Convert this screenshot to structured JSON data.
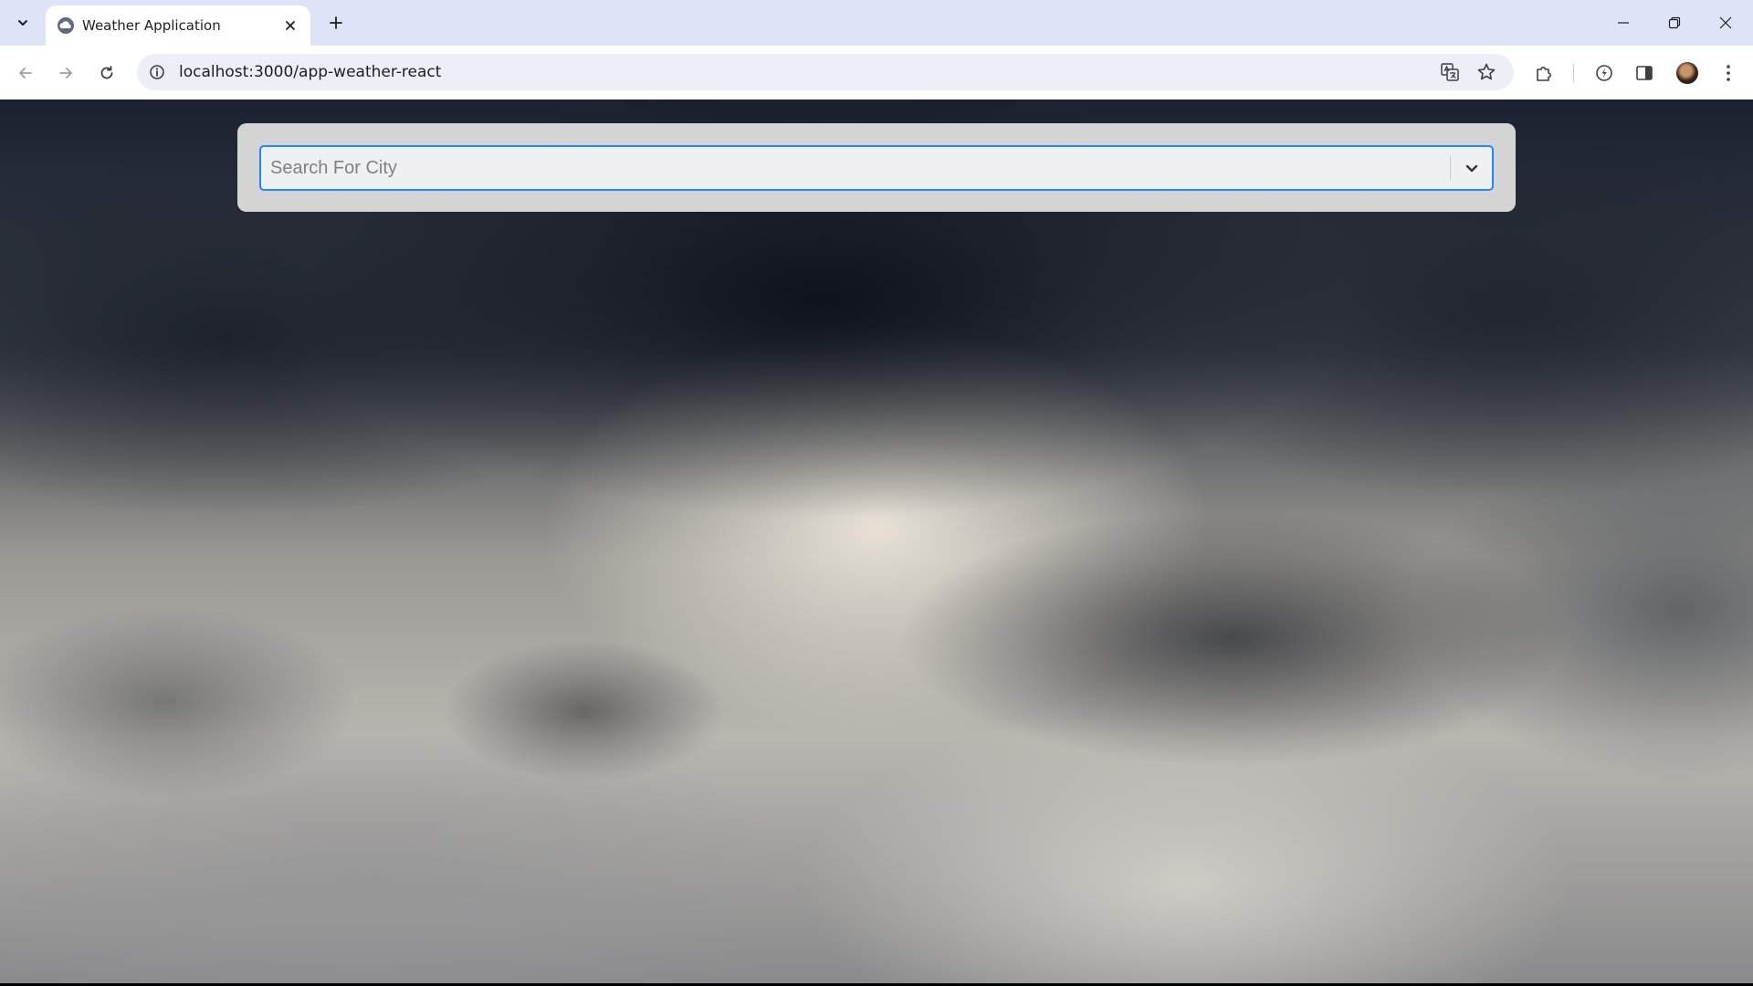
{
  "browser": {
    "tab": {
      "title": "Weather Application",
      "favicon": "cloud-icon"
    },
    "omnibox": {
      "url": "localhost:3000/app-weather-react"
    },
    "icons": {
      "tab_search": "chevron-down-icon",
      "tab_close": "close-icon",
      "new_tab": "plus-icon",
      "minimize": "minimize-icon",
      "restore": "restore-icon",
      "close_window": "close-icon",
      "back": "arrow-left-icon",
      "forward": "arrow-right-icon",
      "reload": "reload-icon",
      "site_info": "info-icon",
      "translate": "translate-icon",
      "bookmark": "star-icon",
      "extensions": "puzzle-icon",
      "performance": "speedometer-icon",
      "side_panel": "side-panel-icon",
      "profile": "avatar",
      "menu": "kebab-menu-icon"
    }
  },
  "page": {
    "search": {
      "placeholder": "Search For City",
      "value": ""
    }
  },
  "colors": {
    "tabstrip_bg": "#dfe3f7",
    "focus_border": "#2684ff",
    "card_bg": "#dcdcdc",
    "placeholder": "#808080"
  }
}
